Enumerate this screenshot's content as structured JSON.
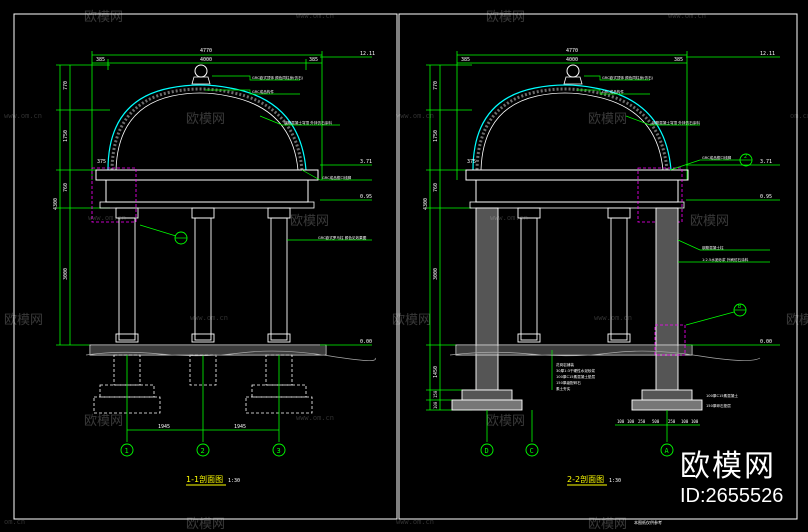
{
  "colors": {
    "background": "#000000",
    "frame": "#ffffff",
    "dim": "#00ff00",
    "structure": "#ffffff",
    "cyan": "#00ffff",
    "leader": "#00ff00",
    "magenta": "#ff00ff",
    "yellow": "#ffff00",
    "hatch": "#9a9a9a"
  },
  "left": {
    "title": "1-1剖面图",
    "scale": "1:30",
    "top_dim_total": "4770",
    "top_dim_inner": "4000",
    "top_dim_left": "385",
    "top_dim_right": "385",
    "side_dims": [
      "770",
      "1750",
      "760",
      "3000",
      "4300"
    ],
    "elevations": [
      "12.11",
      "3.71",
      "0.95",
      "0.00"
    ],
    "overhang_dim": "375",
    "grid": [
      "1",
      "2",
      "3"
    ],
    "bottom_dims": [
      "1945",
      "1945"
    ],
    "notes": [
      "GRC欧式顶饰 颜色同柱身(仿石)",
      "GRC成品构件",
      "钢筋混凝土穹顶 外抹仿石涂料",
      "GRC成品檐口线脚",
      "GRC欧式罗马柱 颜色见效果图"
    ]
  },
  "right": {
    "title": "2-2剖面图",
    "scale": "1:30",
    "top_dim_total": "4770",
    "top_dim_inner": "4000",
    "top_dim_left": "385",
    "top_dim_right": "385",
    "side_dims": [
      "770",
      "1750",
      "760",
      "3000",
      "4300",
      "1450",
      "150",
      "100"
    ],
    "elevations": [
      "12.11",
      "3.71",
      "0.95",
      "0.00"
    ],
    "overhang_dim": "375",
    "grid": [
      "D",
      "C",
      "A"
    ],
    "bottom_dims": [
      "100",
      "100",
      "250",
      "500",
      "250",
      "100",
      "100"
    ],
    "callouts": [
      "2",
      "B"
    ],
    "notes": [
      "GRC欧式顶饰 颜色同柱身(仿石)",
      "GRC成品构件",
      "钢筋混凝土穹顶 外抹仿石涂料",
      "GRC成品檐口线脚",
      "钢筋混凝土柱",
      "1:2.5水泥砂浆 外刷仿石涂料",
      "花岗岩铺装",
      "30厚1:3干硬性水泥砂浆",
      "100厚C15素混凝土垫层",
      "150厚级配碎石",
      "素土夯实",
      "100厚C15素混凝土",
      "150厚碎石垫层"
    ],
    "footer": "本图纸仅供参考"
  },
  "watermark": {
    "brand": "欧模网",
    "site": "www.om.cn",
    "domain": "om.cn"
  },
  "brand_badge": {
    "name": "欧模网",
    "id": "ID:2655526"
  }
}
